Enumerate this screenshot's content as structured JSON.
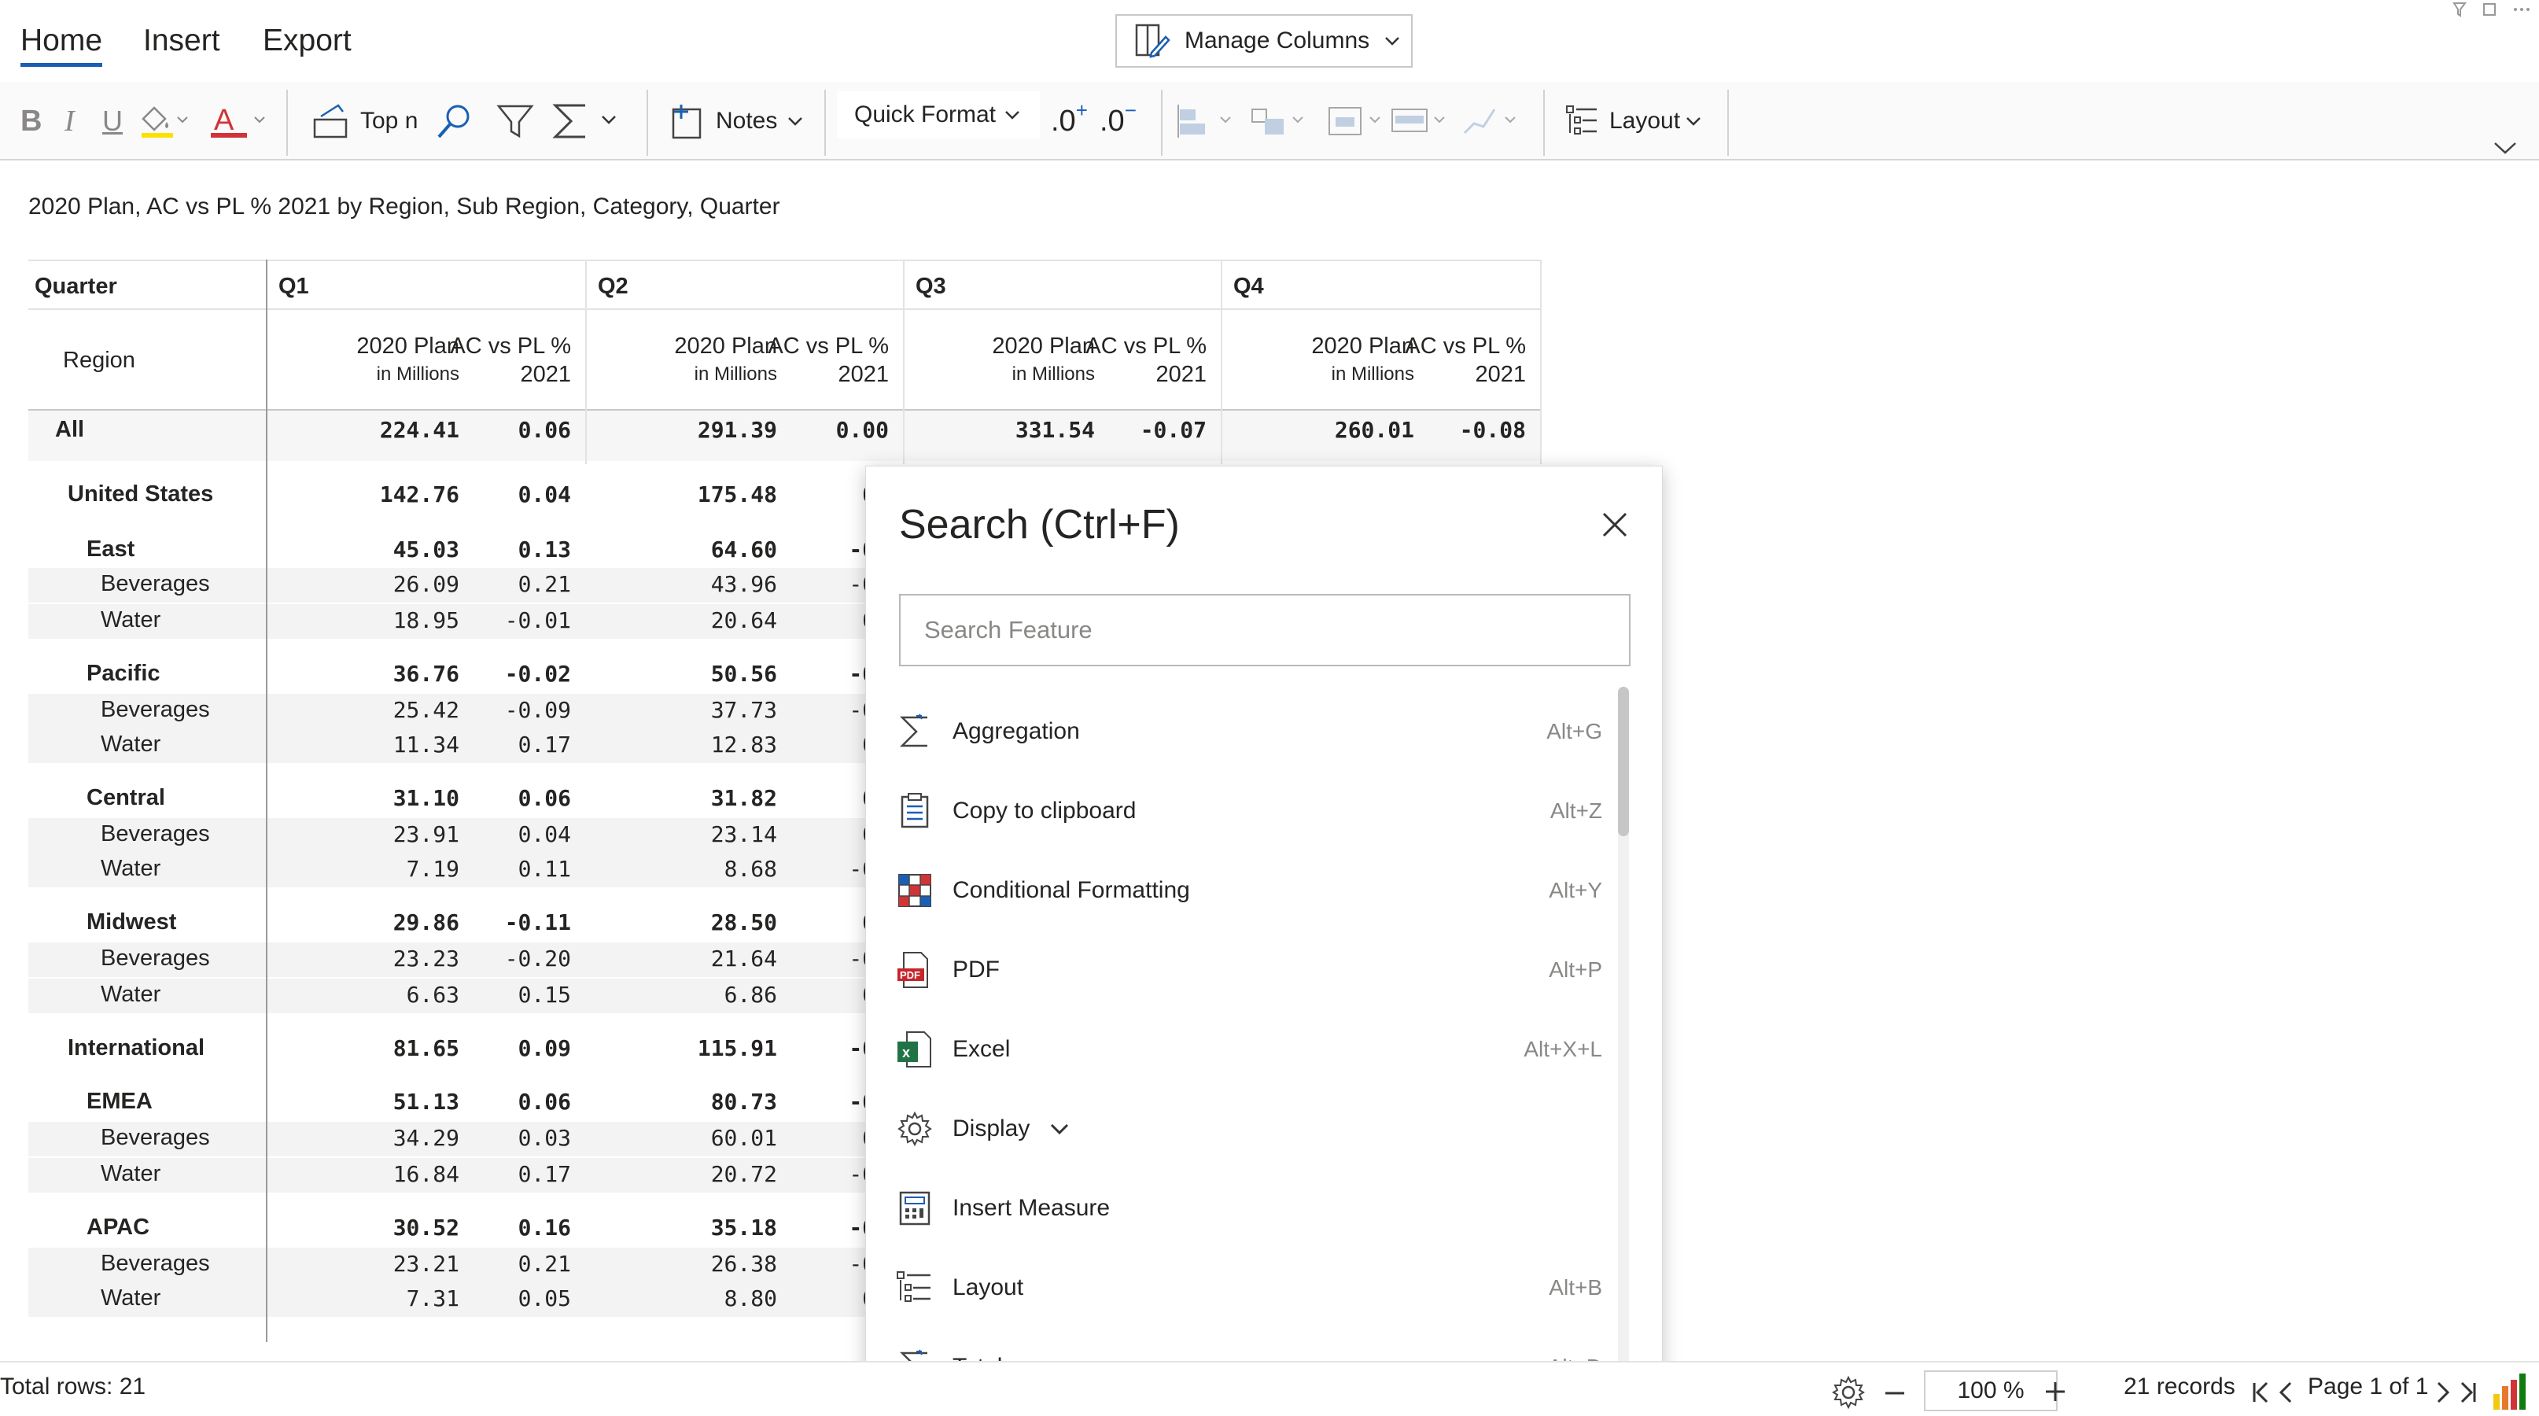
{
  "ribbon": {
    "tabs": [
      "Home",
      "Insert",
      "Export"
    ],
    "manage_columns": "Manage Columns",
    "top_n": "Top n",
    "notes": "Notes",
    "quick_format": "Quick Format",
    "layout": "Layout",
    "decimal_inc": ".0",
    "decimal_dec": ".0"
  },
  "report": {
    "title": "2020 Plan, AC vs PL % 2021 by Region, Sub Region, Category, Quarter",
    "quarter_label": "Quarter",
    "region_label": "Region",
    "quarters": [
      "Q1",
      "Q2",
      "Q3",
      "Q4"
    ],
    "measure_plan": "2020 Plan",
    "measure_plan_unit": "in Millions",
    "measure_ac": "AC vs PL %",
    "measure_ac_year": "2021",
    "rows": [
      {
        "label": "All",
        "level": 0,
        "bold": true,
        "values": [
          "224.41",
          "0.06",
          "291.39",
          "0.00",
          "331.54",
          "-0.07",
          "260.01",
          "-0.08"
        ]
      },
      {
        "label": "United States",
        "level": 1,
        "bold": true,
        "values": [
          "142.76",
          "0.04",
          "175.48",
          "0.",
          null,
          null,
          null,
          null
        ]
      },
      {
        "label": "East",
        "level": 2,
        "bold": true,
        "values": [
          "45.03",
          "0.13",
          "64.60",
          "-0.",
          null,
          null,
          null,
          null
        ]
      },
      {
        "label": "Beverages",
        "level": 3,
        "bold": false,
        "values": [
          "26.09",
          "0.21",
          "43.96",
          "-0.",
          null,
          null,
          null,
          null
        ]
      },
      {
        "label": "Water",
        "level": 3,
        "bold": false,
        "values": [
          "18.95",
          "-0.01",
          "20.64",
          "0.",
          null,
          null,
          null,
          null
        ]
      },
      {
        "label": "Pacific",
        "level": 2,
        "bold": true,
        "values": [
          "36.76",
          "-0.02",
          "50.56",
          "-0.",
          null,
          null,
          null,
          null
        ]
      },
      {
        "label": "Beverages",
        "level": 3,
        "bold": false,
        "values": [
          "25.42",
          "-0.09",
          "37.73",
          "-0.",
          null,
          null,
          null,
          null
        ]
      },
      {
        "label": "Water",
        "level": 3,
        "bold": false,
        "values": [
          "11.34",
          "0.17",
          "12.83",
          "0.",
          null,
          null,
          null,
          null
        ]
      },
      {
        "label": "Central",
        "level": 2,
        "bold": true,
        "values": [
          "31.10",
          "0.06",
          "31.82",
          "0.",
          null,
          null,
          null,
          null
        ]
      },
      {
        "label": "Beverages",
        "level": 3,
        "bold": false,
        "values": [
          "23.91",
          "0.04",
          "23.14",
          "0.",
          null,
          null,
          null,
          null
        ]
      },
      {
        "label": "Water",
        "level": 3,
        "bold": false,
        "values": [
          "7.19",
          "0.11",
          "8.68",
          "-0.",
          null,
          null,
          null,
          null
        ]
      },
      {
        "label": "Midwest",
        "level": 2,
        "bold": true,
        "values": [
          "29.86",
          "-0.11",
          "28.50",
          "0.",
          null,
          null,
          null,
          null
        ]
      },
      {
        "label": "Beverages",
        "level": 3,
        "bold": false,
        "values": [
          "23.23",
          "-0.20",
          "21.64",
          "-0.",
          null,
          null,
          null,
          null
        ]
      },
      {
        "label": "Water",
        "level": 3,
        "bold": false,
        "values": [
          "6.63",
          "0.15",
          "6.86",
          "0.",
          null,
          null,
          null,
          null
        ]
      },
      {
        "label": "International",
        "level": 1,
        "bold": true,
        "values": [
          "81.65",
          "0.09",
          "115.91",
          "-0.",
          null,
          null,
          null,
          null
        ]
      },
      {
        "label": "EMEA",
        "level": 2,
        "bold": true,
        "values": [
          "51.13",
          "0.06",
          "80.73",
          "-0.",
          null,
          null,
          null,
          null
        ]
      },
      {
        "label": "Beverages",
        "level": 3,
        "bold": false,
        "values": [
          "34.29",
          "0.03",
          "60.01",
          "0.",
          null,
          null,
          null,
          null
        ]
      },
      {
        "label": "Water",
        "level": 3,
        "bold": false,
        "values": [
          "16.84",
          "0.17",
          "20.72",
          "-0.",
          null,
          null,
          null,
          null
        ]
      },
      {
        "label": "APAC",
        "level": 2,
        "bold": true,
        "values": [
          "30.52",
          "0.16",
          "35.18",
          "-0.",
          null,
          null,
          null,
          null
        ]
      },
      {
        "label": "Beverages",
        "level": 3,
        "bold": false,
        "values": [
          "23.21",
          "0.21",
          "26.38",
          "-0.",
          null,
          null,
          null,
          null
        ]
      },
      {
        "label": "Water",
        "level": 3,
        "bold": false,
        "values": [
          "7.31",
          "0.05",
          "8.80",
          "0.",
          null,
          null,
          null,
          null
        ]
      }
    ]
  },
  "search_panel": {
    "title": "Search (Ctrl+F)",
    "placeholder": "Search Feature",
    "items": [
      {
        "name": "Aggregation",
        "shortcut": "Alt+G",
        "icon": "sigma-icon"
      },
      {
        "name": "Copy to clipboard",
        "shortcut": "Alt+Z",
        "icon": "clipboard-icon"
      },
      {
        "name": "Conditional Formatting",
        "shortcut": "Alt+Y",
        "icon": "conditional-formatting-icon"
      },
      {
        "name": "PDF",
        "shortcut": "Alt+P",
        "icon": "pdf-icon"
      },
      {
        "name": "Excel",
        "shortcut": "Alt+X+L",
        "icon": "excel-icon"
      },
      {
        "name": "Display",
        "shortcut": "",
        "icon": "gear-icon"
      },
      {
        "name": "Insert Measure",
        "shortcut": "",
        "icon": "calculator-icon"
      },
      {
        "name": "Layout",
        "shortcut": "Alt+B",
        "icon": "layout-icon"
      },
      {
        "name": "Total",
        "shortcut": "Alt+D",
        "icon": "sigma-icon"
      }
    ]
  },
  "status": {
    "total_rows": "Total rows: 21",
    "zoom": "100 %",
    "records": "21 records",
    "page": "Page 1 of 1"
  },
  "colors": {
    "accent": "#1a5fb4",
    "font_red": "#d13438",
    "highlight_yellow": "#fce100",
    "excel_green": "#217346",
    "pdf_red": "#c4262e"
  }
}
